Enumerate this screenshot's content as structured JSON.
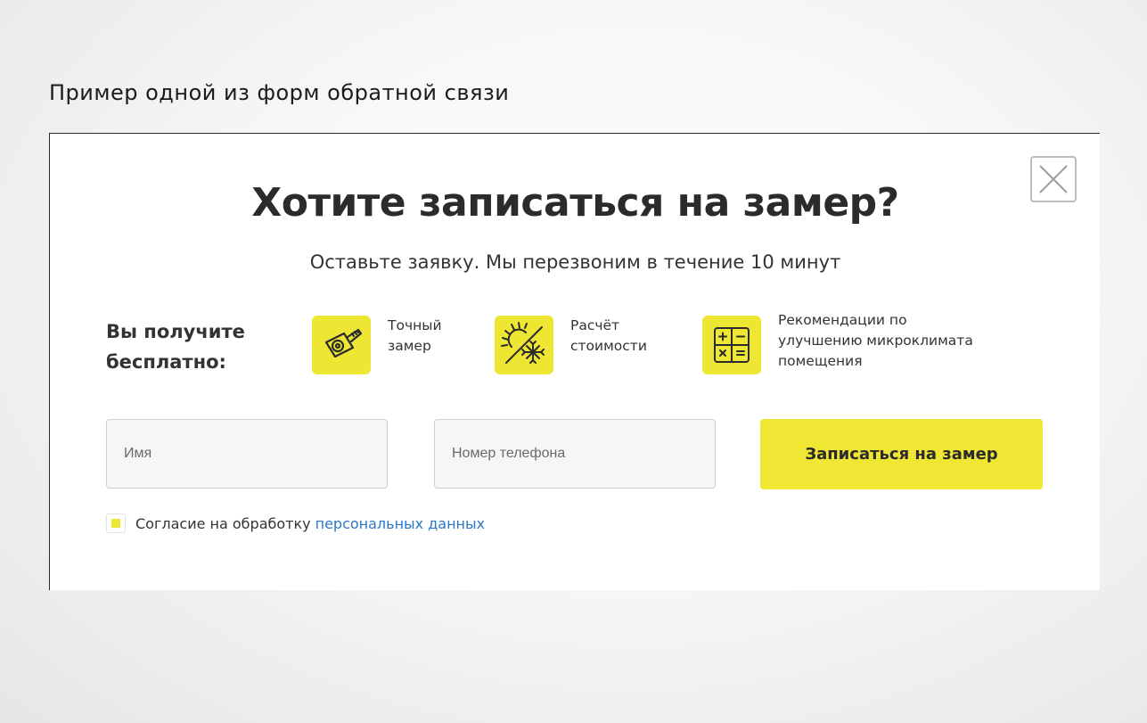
{
  "caption": "Пример одной из форм обратной связи",
  "modal": {
    "title": "Хотите записаться на замер?",
    "subtitle": "Оставьте заявку. Мы перезвоним в течение 10 минут",
    "close_icon": "close-icon",
    "benefits_heading": "Вы получите\nбесплатно:",
    "benefits": [
      {
        "icon": "tape-measure-icon",
        "label": "Точный\nзамер"
      },
      {
        "icon": "sun-snowflake-icon",
        "label": "Расчёт\nстоимости"
      },
      {
        "icon": "calculator-icon",
        "label": "Рекомендации по\n улучшению микроклимата\nпомещения"
      }
    ],
    "form": {
      "name_placeholder": "Имя",
      "phone_placeholder": "Номер телефона",
      "submit_label": "Записаться на замер"
    },
    "consent": {
      "text": "Согласие на обработку",
      "link_text": "персональных данных",
      "checked": true
    }
  },
  "colors": {
    "accent": "#f0e634",
    "link": "#2a78c7",
    "text": "#333333"
  }
}
